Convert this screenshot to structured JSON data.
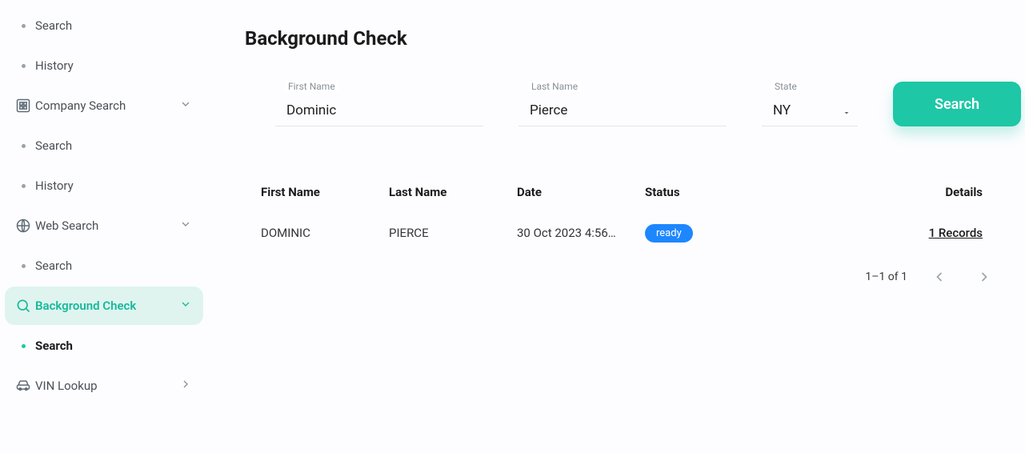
{
  "sidebar": {
    "items": [
      {
        "label": "Search",
        "icon": "dot",
        "expandable": false,
        "active": false,
        "bold": false
      },
      {
        "label": "History",
        "icon": "dot",
        "expandable": false,
        "active": false,
        "bold": false
      },
      {
        "label": "Company Search",
        "icon": "company",
        "expandable": true,
        "active": false,
        "bold": false
      },
      {
        "label": "Search",
        "icon": "dot",
        "expandable": false,
        "active": false,
        "bold": false
      },
      {
        "label": "History",
        "icon": "dot",
        "expandable": false,
        "active": false,
        "bold": false
      },
      {
        "label": "Web Search",
        "icon": "globe",
        "expandable": true,
        "active": false,
        "bold": false
      },
      {
        "label": "Search",
        "icon": "dot",
        "expandable": false,
        "active": false,
        "bold": false
      },
      {
        "label": "Background Check",
        "icon": "search",
        "expandable": true,
        "active": true,
        "bold": false
      },
      {
        "label": "Search",
        "icon": "dot-solid",
        "expandable": false,
        "active": false,
        "bold": true
      },
      {
        "label": "VIN Lookup",
        "icon": "car",
        "expandable": true,
        "chevron": "right",
        "active": false,
        "bold": false
      }
    ]
  },
  "page": {
    "title": "Background Check"
  },
  "form": {
    "first_name": {
      "label": "First Name",
      "value": "Dominic"
    },
    "last_name": {
      "label": "Last Name",
      "value": "Pierce"
    },
    "state": {
      "label": "State",
      "value": "NY"
    },
    "search_button": "Search"
  },
  "table": {
    "headers": {
      "first_name": "First Name",
      "last_name": "Last Name",
      "date": "Date",
      "status": "Status",
      "details": "Details"
    },
    "rows": [
      {
        "first_name": "DOMINIC",
        "last_name": "PIERCE",
        "date": "30 Oct 2023 4:56…",
        "status": "ready",
        "details": "1 Records"
      }
    ]
  },
  "pagination": {
    "range": "1–1 of 1"
  }
}
